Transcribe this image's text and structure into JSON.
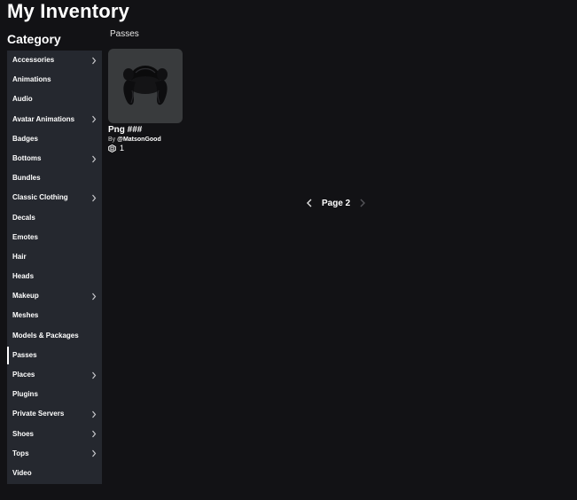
{
  "header": {
    "title": "My Inventory",
    "category_heading": "Category"
  },
  "sidebar": {
    "items": [
      {
        "label": "Accessories",
        "chevron": true
      },
      {
        "label": "Animations",
        "chevron": false
      },
      {
        "label": "Audio",
        "chevron": false
      },
      {
        "label": "Avatar Animations",
        "chevron": true
      },
      {
        "label": "Badges",
        "chevron": false
      },
      {
        "label": "Bottoms",
        "chevron": true
      },
      {
        "label": "Bundles",
        "chevron": false
      },
      {
        "label": "Classic Clothing",
        "chevron": true
      },
      {
        "label": "Decals",
        "chevron": false
      },
      {
        "label": "Emotes",
        "chevron": false
      },
      {
        "label": "Hair",
        "chevron": false
      },
      {
        "label": "Heads",
        "chevron": false
      },
      {
        "label": "Makeup",
        "chevron": true
      },
      {
        "label": "Meshes",
        "chevron": false
      },
      {
        "label": "Models & Packages",
        "chevron": false
      },
      {
        "label": "Passes",
        "chevron": false,
        "active": true
      },
      {
        "label": "Places",
        "chevron": true
      },
      {
        "label": "Plugins",
        "chevron": false
      },
      {
        "label": "Private Servers",
        "chevron": true
      },
      {
        "label": "Shoes",
        "chevron": true
      },
      {
        "label": "Tops",
        "chevron": true
      },
      {
        "label": "Video",
        "chevron": false
      }
    ]
  },
  "main": {
    "section_label": "Passes",
    "items": [
      {
        "name": "Png ###",
        "by_label": "By",
        "creator": "@MatsonGood",
        "price": "1",
        "thumbnail_icon": "hair-thumbnail-icon",
        "currency_icon": "robux-icon"
      }
    ]
  },
  "pagination": {
    "label": "Page 2",
    "prev_icon": "chevron-left-icon",
    "next_icon": "chevron-right-icon"
  },
  "colors": {
    "background": "#121215",
    "sidebar": "#25282f",
    "thumbnail": "#393b3d",
    "text": "#ffffff"
  }
}
